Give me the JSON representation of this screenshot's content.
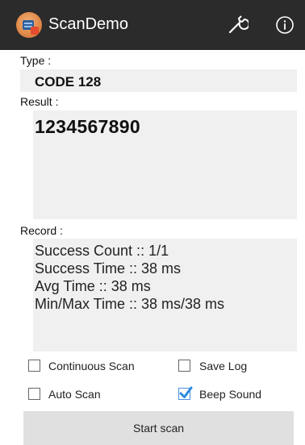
{
  "appbar": {
    "title": "ScanDemo",
    "icons": {
      "app": "scanner-app-icon",
      "settings": "wrench-icon",
      "info": "info-icon"
    },
    "background": "#2b2b2b"
  },
  "type": {
    "label": "Type :",
    "value": "CODE 128"
  },
  "result": {
    "label": "Result :",
    "value": "1234567890"
  },
  "record": {
    "label": "Record :",
    "lines": [
      "Success Count :: 1/1",
      "Success Time :: 38 ms",
      "Avg Time :: 38 ms",
      "Min/Max Time :: 38 ms/38 ms"
    ]
  },
  "options": {
    "continuous_scan": {
      "label": "Continuous Scan",
      "checked": false
    },
    "save_log": {
      "label": "Save Log",
      "checked": false
    },
    "auto_scan": {
      "label": "Auto Scan",
      "checked": false
    },
    "beep_sound": {
      "label": "Beep Sound",
      "checked": true
    }
  },
  "start_button": {
    "label": "Start scan"
  },
  "colors": {
    "box_background": "#f0f0f0",
    "check_accent": "#4a90e2",
    "button_background": "#e0e0e0"
  }
}
